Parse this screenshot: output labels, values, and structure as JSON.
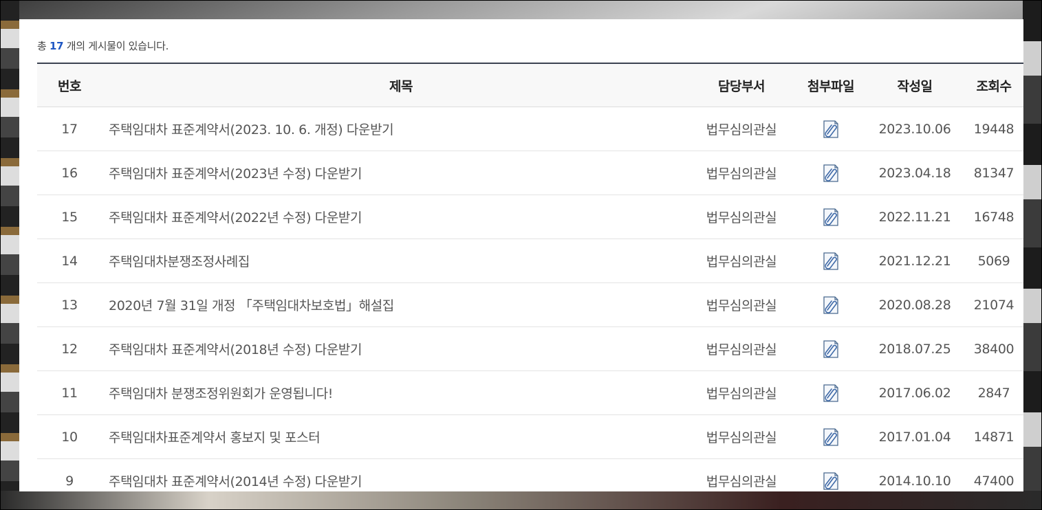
{
  "summary": {
    "prefix": "총",
    "count": "17",
    "suffix": "개의 게시물이 있습니다."
  },
  "headers": {
    "no": "번호",
    "title": "제목",
    "dept": "담당부서",
    "file": "첨부파일",
    "date": "작성일",
    "views": "조회수"
  },
  "icons": {
    "attachment": "paperclip-icon"
  },
  "colors": {
    "accent": "#1f57c3",
    "header_border": "#3a4150"
  },
  "rows": [
    {
      "no": "17",
      "title": "주택임대차 표준계약서(2023. 10. 6. 개정) 다운받기",
      "dept": "법무심의관실",
      "date": "2023.10.06",
      "views": "19448"
    },
    {
      "no": "16",
      "title": "주택임대차 표준계약서(2023년 수정) 다운받기",
      "dept": "법무심의관실",
      "date": "2023.04.18",
      "views": "81347"
    },
    {
      "no": "15",
      "title": "주택임대차 표준계약서(2022년 수정) 다운받기",
      "dept": "법무심의관실",
      "date": "2022.11.21",
      "views": "16748"
    },
    {
      "no": "14",
      "title": "주택임대차분쟁조정사례집",
      "dept": "법무심의관실",
      "date": "2021.12.21",
      "views": "5069"
    },
    {
      "no": "13",
      "title": "2020년 7월 31일 개정 「주택임대차보호법」해설집",
      "dept": "법무심의관실",
      "date": "2020.08.28",
      "views": "21074"
    },
    {
      "no": "12",
      "title": "주택임대차 표준계약서(2018년 수정) 다운받기",
      "dept": "법무심의관실",
      "date": "2018.07.25",
      "views": "38400"
    },
    {
      "no": "11",
      "title": "주택임대차 분쟁조정위원회가 운영됩니다!",
      "dept": "법무심의관실",
      "date": "2017.06.02",
      "views": "2847"
    },
    {
      "no": "10",
      "title": "주택임대차표준계약서 홍보지 및 포스터",
      "dept": "법무심의관실",
      "date": "2017.01.04",
      "views": "14871"
    },
    {
      "no": "9",
      "title": "주택임대차 표준계약서(2014년 수정) 다운받기",
      "dept": "법무심의관실",
      "date": "2014.10.10",
      "views": "47400"
    }
  ]
}
